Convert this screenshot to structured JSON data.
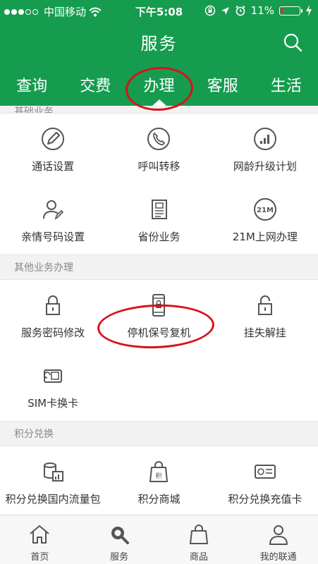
{
  "status": {
    "carrier": "中国移动",
    "time": "下午5:08",
    "battery": "11%",
    "battery_level": 0.11,
    "signal_dots": 3
  },
  "header": {
    "title": "服务",
    "search_icon": "search-icon"
  },
  "tabs": [
    {
      "label": "查询",
      "active": false
    },
    {
      "label": "交费",
      "active": false
    },
    {
      "label": "办理",
      "active": true
    },
    {
      "label": "客服",
      "active": false
    },
    {
      "label": "生活",
      "active": false
    }
  ],
  "sections": [
    {
      "title": "基础业务",
      "items": [
        {
          "label": "通话设置",
          "icon": "pencil-icon"
        },
        {
          "label": "呼叫转移",
          "icon": "phone-icon"
        },
        {
          "label": "网龄升级计划",
          "icon": "signal-icon"
        },
        {
          "label": "亲情号码设置",
          "icon": "user-edit-icon"
        },
        {
          "label": "省份业务",
          "icon": "document-icon"
        },
        {
          "label": "21M上网办理",
          "icon": "21m-icon"
        }
      ]
    },
    {
      "title": "其他业务办理",
      "items": [
        {
          "label": "服务密码修改",
          "icon": "lock-icon"
        },
        {
          "label": "停机保号复机",
          "icon": "phone-lock-icon"
        },
        {
          "label": "挂失解挂",
          "icon": "unlock-icon"
        },
        {
          "label": "SIM卡换卡",
          "icon": "sim-card-icon"
        }
      ]
    },
    {
      "title": "积分兑换",
      "items": [
        {
          "label": "积分兑换国内流量包",
          "icon": "data-chart-icon"
        },
        {
          "label": "积分商城",
          "icon": "points-bag-icon"
        },
        {
          "label": "积分兑换充值卡",
          "icon": "recharge-card-icon"
        }
      ]
    }
  ],
  "bottom_nav": [
    {
      "label": "首页",
      "icon": "home-icon"
    },
    {
      "label": "服务",
      "icon": "search-icon"
    },
    {
      "label": "商品",
      "icon": "bag-icon"
    },
    {
      "label": "我的联通",
      "icon": "person-icon"
    }
  ],
  "colors": {
    "brand_green": "#169c4f",
    "annotation_red": "#d8121b"
  }
}
